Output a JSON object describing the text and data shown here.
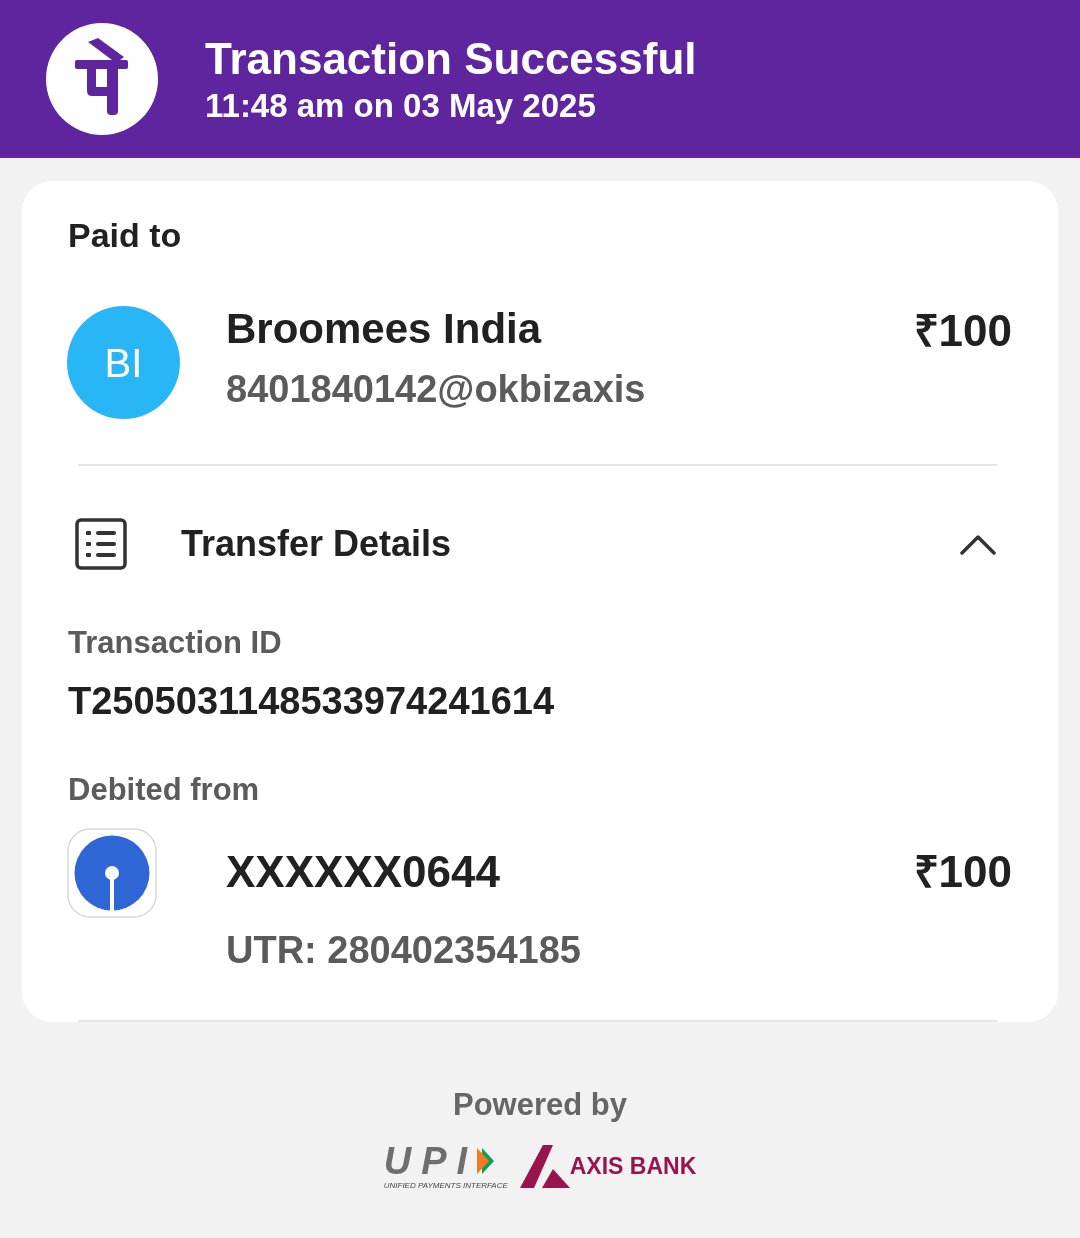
{
  "header": {
    "title": "Transaction Successful",
    "subtitle": "11:48 am on 03 May 2025"
  },
  "payee": {
    "heading": "Paid to",
    "initials": "BI",
    "name": "Broomees India",
    "upi_id": "8401840142@okbizaxis",
    "amount": "₹100"
  },
  "transfer_details": {
    "title": "Transfer Details",
    "expanded": true,
    "transaction_id_label": "Transaction ID",
    "transaction_id": "T2505031148533974241614",
    "debited_label": "Debited from",
    "account": "XXXXXX0644",
    "amount": "₹100",
    "utr": "UTR: 280402354185"
  },
  "footer": {
    "powered_by": "Powered by",
    "upi_wordmark": "UPI",
    "upi_tagline": "UNIFIED PAYMENTS INTERFACE",
    "bank_name": "AXIS BANK"
  }
}
